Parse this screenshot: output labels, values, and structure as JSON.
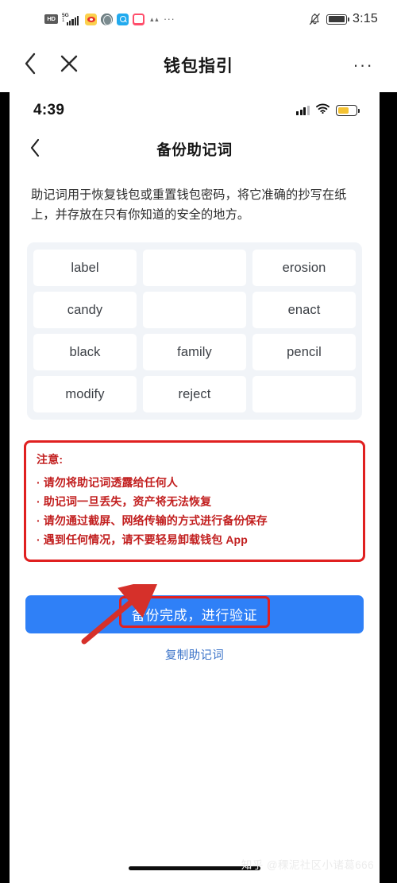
{
  "outer": {
    "status": {
      "hd_label": "HD",
      "network_label": "5G",
      "network_sub": "1",
      "icons": [
        "hd-icon",
        "signal-5g-icon",
        "weibo-icon",
        "browser-globe-icon",
        "search-app-icon",
        "pink-app-icon",
        "tiny-app-icon",
        "more-apps-icon"
      ],
      "more_apps": "···",
      "notifications_muted": "bell-muted-icon",
      "battery": "battery-icon",
      "time": "3:15"
    },
    "nav": {
      "back": "‹",
      "close": "×",
      "title": "钱包指引",
      "more": "···"
    }
  },
  "inner": {
    "status": {
      "time": "4:39",
      "signal": "cellular-signal-icon",
      "wifi": "wifi-icon",
      "battery": "battery-low-power-icon"
    },
    "nav": {
      "back": "‹",
      "title": "备份助记词"
    },
    "description": "助记词用于恢复钱包或重置钱包密码，将它准确的抄写在纸上，并存放在只有你知道的安全的地方。",
    "mnemonic_words": [
      "label",
      "",
      "erosion",
      "candy",
      "",
      "enact",
      "black",
      "family",
      "pencil",
      "modify",
      "reject",
      ""
    ],
    "warning": {
      "title": "注意:",
      "lines": [
        "· 请勿将助记词透露给任何人",
        "· 助记词一旦丢失，资产将无法恢复",
        "· 请勿通过截屏、网络传输的方式进行备份保存",
        "· 遇到任何情况，请不要轻易卸载钱包 App"
      ]
    },
    "primary_button": "备份完成，进行验证",
    "copy_link": "复制助记词",
    "watermark": "知乎 @稞泥社区小诸葛666"
  },
  "colors": {
    "primary_blue": "#2f80f7",
    "annotation_red": "#e02020",
    "warning_red": "#c22020",
    "link_blue": "#3c74c9",
    "grid_bg": "#f1f4f8",
    "battery_yellow": "#f4c233"
  }
}
